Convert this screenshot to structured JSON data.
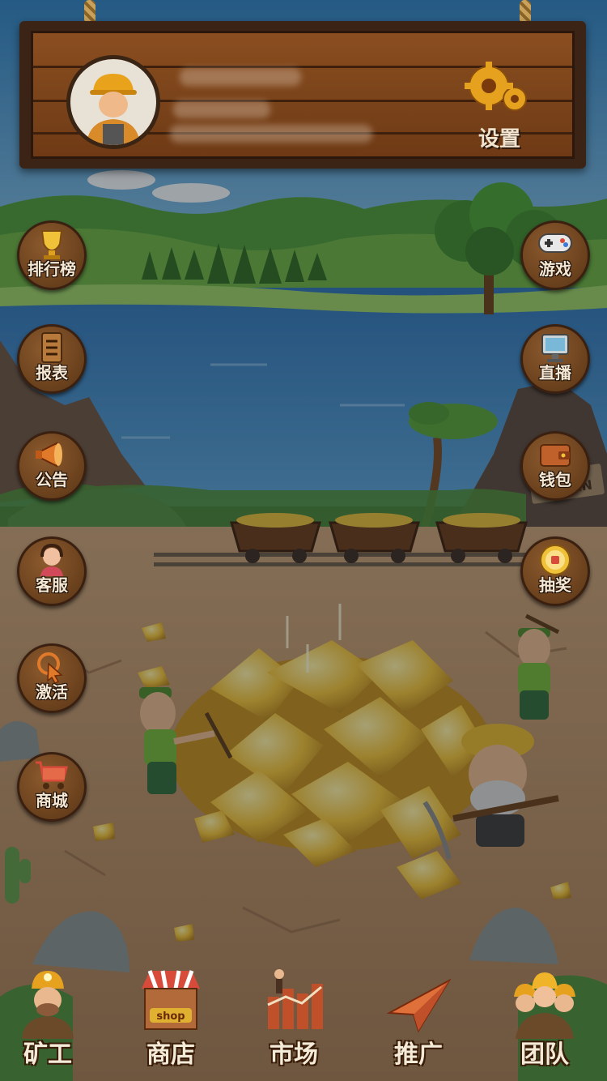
{
  "header": {
    "settings_label": "设置"
  },
  "left_menu": [
    {
      "label": "排行榜",
      "icon": "trophy-icon"
    },
    {
      "label": "报表",
      "icon": "report-icon"
    },
    {
      "label": "公告",
      "icon": "megaphone-icon"
    },
    {
      "label": "客服",
      "icon": "support-agent-icon"
    },
    {
      "label": "激活",
      "icon": "cursor-click-icon"
    },
    {
      "label": "商城",
      "icon": "shopping-cart-icon"
    }
  ],
  "right_menu": [
    {
      "label": "游戏",
      "icon": "gamepad-icon"
    },
    {
      "label": "直播",
      "icon": "live-screen-icon"
    },
    {
      "label": "钱包",
      "icon": "wallet-icon"
    },
    {
      "label": "抽奖",
      "icon": "prize-wheel-icon"
    }
  ],
  "bottom_nav": [
    {
      "label": "矿工",
      "icon": "miner-icon"
    },
    {
      "label": "商店",
      "icon": "shop-stall-icon"
    },
    {
      "label": "市场",
      "icon": "market-chart-icon"
    },
    {
      "label": "推广",
      "icon": "paper-plane-icon"
    },
    {
      "label": "团队",
      "icon": "team-icon"
    }
  ],
  "scene": {
    "shop_sign": "shop",
    "mine_sign": "RT\nLEN"
  }
}
